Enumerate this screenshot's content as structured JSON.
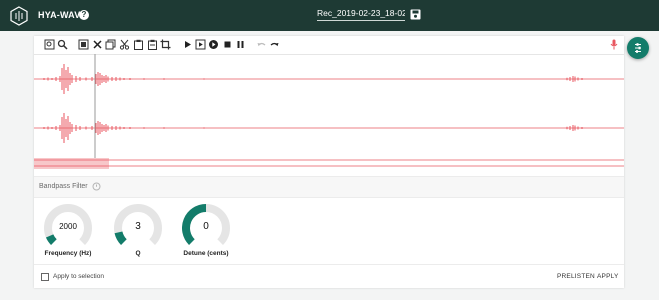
{
  "header": {
    "app_name": "HYA-WAVE",
    "help_icon": "question-icon",
    "filename": "Rec_2019-02-23_18-02-6",
    "save_icon": "floppy-disk-icon"
  },
  "toolbar": {
    "icons": [
      "zoom-fit-icon",
      "zoom-icon",
      "select-all-icon",
      "close-icon",
      "copy-icon",
      "cut-icon",
      "paste-icon",
      "paste-special-icon",
      "crop-icon",
      "play-icon",
      "play-selection-icon",
      "record-icon",
      "stop-icon",
      "pause-icon",
      "undo-icon",
      "redo-icon"
    ],
    "mic_icon": "microphone-icon"
  },
  "waveform": {
    "color": "#e8565f",
    "selection_color": "#f7c7c9",
    "cursor_color": "#9a9a9a"
  },
  "filter": {
    "title": "Bandpass Filter",
    "title_icon": "filter-icon",
    "knobs": [
      {
        "label": "Frequency (Hz)",
        "value": "2000",
        "level": 0.08
      },
      {
        "label": "Q",
        "value": "3",
        "level": 0.12
      },
      {
        "label": "Detune (cents)",
        "value": "0",
        "level": 0.5
      }
    ]
  },
  "footer": {
    "apply_to_selection": "Apply to selection",
    "prelisten": "PRELISTEN",
    "apply": "APPLY"
  },
  "colors": {
    "topbar": "#1e3a34",
    "accent": "#137c6a",
    "knob_track": "#e5e5e5"
  },
  "fab_icon": "sliders-icon"
}
